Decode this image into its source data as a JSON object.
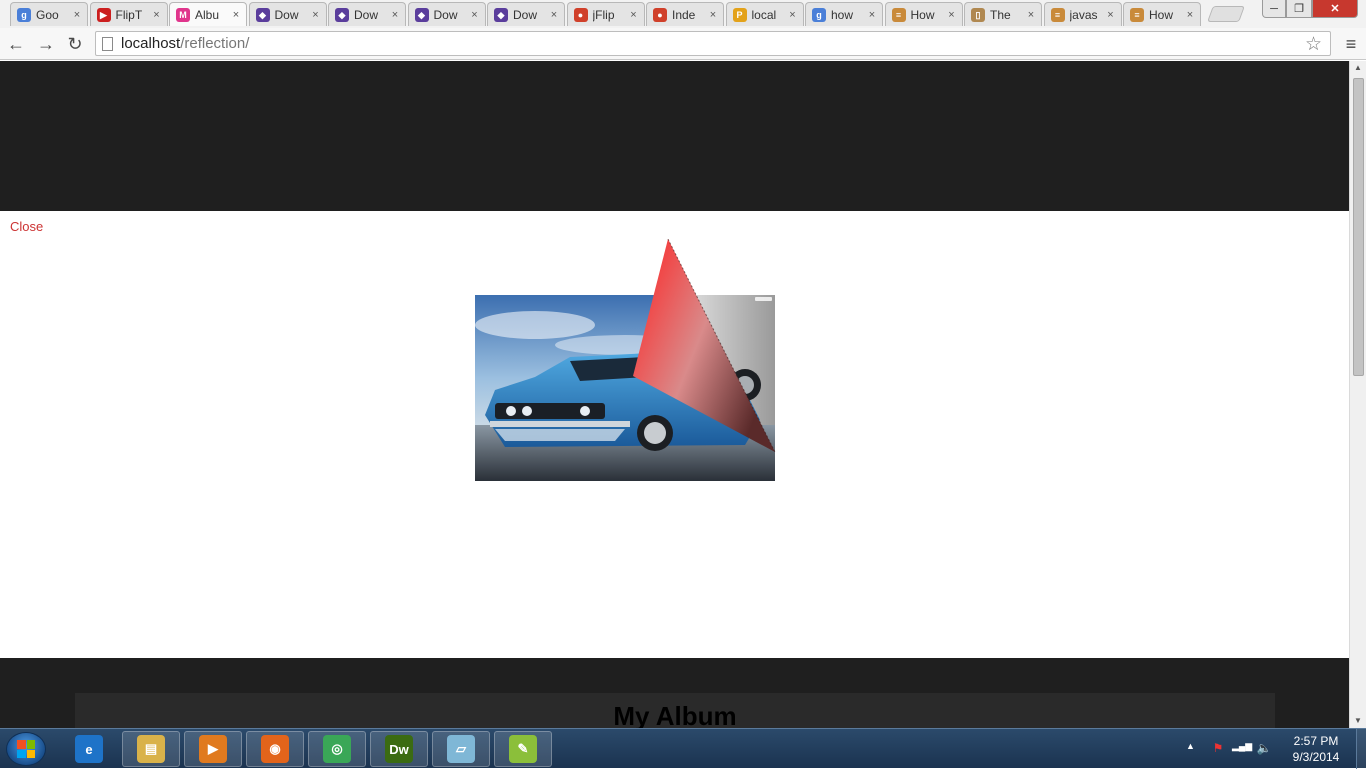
{
  "browser": {
    "tabs": [
      {
        "label": "Goo",
        "icon": "google-icon",
        "color": "#4a7fd8",
        "glyph": "g"
      },
      {
        "label": "FlipT",
        "icon": "youtube-icon",
        "color": "#cc1f1f",
        "glyph": "▶"
      },
      {
        "label": "Albu",
        "icon": "album-site-icon",
        "color": "#e0358c",
        "glyph": "M",
        "active": true
      },
      {
        "label": "Dow",
        "icon": "download-icon",
        "color": "#5a3d9c",
        "glyph": "◆"
      },
      {
        "label": "Dow",
        "icon": "download-icon",
        "color": "#5a3d9c",
        "glyph": "◆"
      },
      {
        "label": "Dow",
        "icon": "download-icon",
        "color": "#5a3d9c",
        "glyph": "◆"
      },
      {
        "label": "Dow",
        "icon": "download-icon",
        "color": "#5a3d9c",
        "glyph": "◆"
      },
      {
        "label": "jFlip",
        "icon": "apple-icon",
        "color": "#d0402a",
        "glyph": "●"
      },
      {
        "label": "Inde",
        "icon": "apple-icon",
        "color": "#d0402a",
        "glyph": "●"
      },
      {
        "label": "local",
        "icon": "phpmyadmin-icon",
        "color": "#e3a21a",
        "glyph": "P"
      },
      {
        "label": "how",
        "icon": "google-icon",
        "color": "#4a7fd8",
        "glyph": "g"
      },
      {
        "label": "How",
        "icon": "stackoverflow-icon",
        "color": "#c98a3a",
        "glyph": "≡"
      },
      {
        "label": "The",
        "icon": "book-icon",
        "color": "#b08850",
        "glyph": "▯"
      },
      {
        "label": "javas",
        "icon": "stackoverflow-icon",
        "color": "#c98a3a",
        "glyph": "≡"
      },
      {
        "label": "How",
        "icon": "stackoverflow-icon",
        "color": "#c98a3a",
        "glyph": "≡"
      }
    ],
    "tab_close_glyph": "×",
    "window_buttons": {
      "minimize": "─",
      "maximize": "❐",
      "close": "✕"
    },
    "nav": {
      "back": "←",
      "forward": "→",
      "reload": "↻",
      "menu": "≡",
      "star": "☆"
    },
    "address": {
      "host": "localhost",
      "path": "/reflection/"
    }
  },
  "page": {
    "close_link": "Close",
    "album_title": "My Album"
  },
  "scrollbar": {
    "up": "▲",
    "down": "▼"
  },
  "taskbar": {
    "items": [
      {
        "name": "internet-explorer-icon",
        "glyph": "e",
        "bg": "#1e73c8"
      },
      {
        "name": "file-explorer-icon",
        "glyph": "▤",
        "bg": "#d9b24a"
      },
      {
        "name": "media-player-icon",
        "glyph": "▶",
        "bg": "#e07a1f"
      },
      {
        "name": "firefox-icon",
        "glyph": "◉",
        "bg": "#e2641b"
      },
      {
        "name": "chrome-icon",
        "glyph": "◎",
        "bg": "#3aa757"
      },
      {
        "name": "dreamweaver-icon",
        "glyph": "Dw",
        "bg": "#3b6b12"
      },
      {
        "name": "notepad-icon",
        "glyph": "▱",
        "bg": "#7fb7d6"
      },
      {
        "name": "notepad-plus-plus-icon",
        "glyph": "✎",
        "bg": "#8bbf3a"
      }
    ],
    "tray": {
      "show_hidden": "▲",
      "flag": "⚑",
      "network": "▂▄▆",
      "volume": "🔈"
    },
    "clock": {
      "time": "2:57 PM",
      "date": "9/3/2014"
    }
  }
}
